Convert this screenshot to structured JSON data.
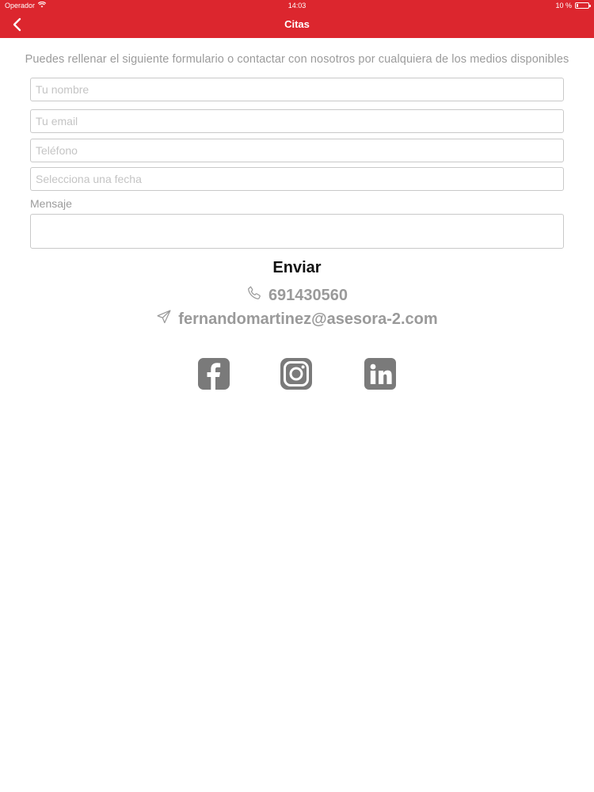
{
  "status_bar": {
    "carrier": "Operador",
    "time": "14:03",
    "battery": "10 %",
    "battery_level": 0.1
  },
  "nav": {
    "title": "Citas",
    "back_icon": "chevron-left-icon"
  },
  "intro_text": "Puedes rellenar el siguiente formulario o contactar con nosotros por cualquiera de los medios disponibles",
  "form": {
    "name_placeholder": "Tu nombre",
    "email_placeholder": "Tu email",
    "phone_placeholder": "Teléfono",
    "date_placeholder": "Selecciona una fecha",
    "message_label": "Mensaje",
    "message_value": "",
    "submit_label": "Enviar"
  },
  "contact": {
    "phone": "691430560",
    "phone_icon": "phone-icon",
    "email": "fernandomartinez@asesora-2.com",
    "email_icon": "send-icon"
  },
  "social": [
    {
      "name": "facebook",
      "icon": "facebook-icon"
    },
    {
      "name": "instagram",
      "icon": "instagram-icon"
    },
    {
      "name": "linkedin",
      "icon": "linkedin-icon"
    }
  ],
  "colors": {
    "header": "#dc262e",
    "icon_gray": "#7a7a7a",
    "contact_text": "#9a9a9a"
  }
}
